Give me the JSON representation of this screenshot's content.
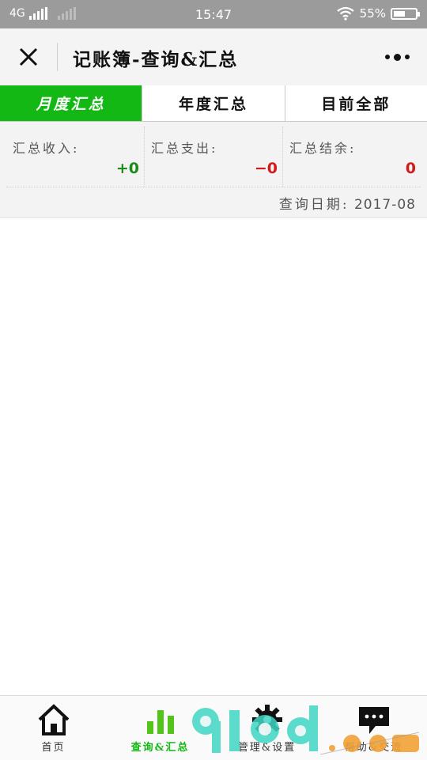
{
  "status_bar": {
    "network": "4G",
    "time": "15:47",
    "battery_percent": "55%",
    "battery_level": 0.55
  },
  "title_bar": {
    "title": "记账簿-查询&汇总",
    "close_icon": "close-icon",
    "more_icon": "more-dots-icon"
  },
  "tabs": [
    {
      "label": "月度汇总",
      "active": true
    },
    {
      "label": "年度汇总",
      "active": false
    },
    {
      "label": "目前全部",
      "active": false
    }
  ],
  "summary": {
    "income_label": "汇总收入:",
    "income_value": "+0",
    "expense_label": "汇总支出:",
    "expense_value": "−0",
    "balance_label": "汇总结余:",
    "balance_value": "0",
    "date_label": "查询日期:",
    "date_value": "2017-08"
  },
  "bottom_nav": [
    {
      "label": "首页",
      "icon": "home-icon",
      "active": false
    },
    {
      "label": "查询&汇总",
      "icon": "bar-chart-icon",
      "active": true
    },
    {
      "label": "管理&设置",
      "icon": "gear-icon",
      "active": false
    },
    {
      "label": "帮助&交流",
      "icon": "chat-bubble-icon",
      "active": false
    }
  ],
  "colors": {
    "accent_green": "#14b814",
    "income_green": "#1a8c1a",
    "expense_red": "#d11a1a",
    "status_bar_gray": "#9b9b9b"
  }
}
